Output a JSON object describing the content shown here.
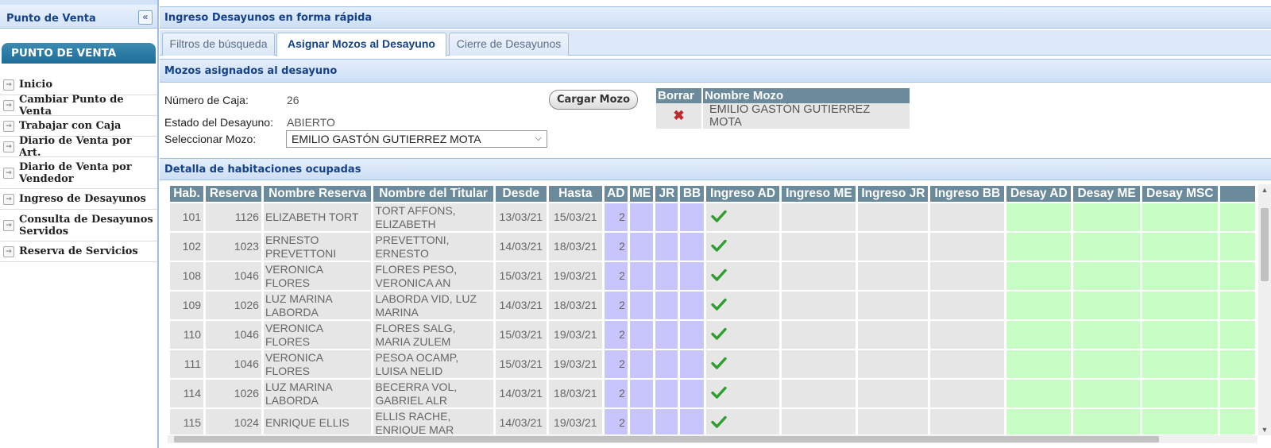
{
  "sidebar": {
    "title": "Punto de Venta",
    "collapse_icon": "«",
    "section_header": "PUNTO DE VENTA",
    "items": [
      {
        "label": "Inicio"
      },
      {
        "label": "Cambiar Punto de Venta"
      },
      {
        "label": "Trabajar con Caja"
      },
      {
        "label": "Diario de Venta por Art."
      },
      {
        "label": "Diario de Venta por Vendedor"
      },
      {
        "label": "Ingreso de Desayunos"
      },
      {
        "label": "Consulta de Desayunos Servidos"
      },
      {
        "label": "Reserva de Servicios"
      }
    ]
  },
  "main": {
    "title": "Ingreso Desayunos en forma rápida",
    "tabs": [
      {
        "label": "Filtros de búsqueda"
      },
      {
        "label": "Asignar Mozos al Desayuno"
      },
      {
        "label": "Cierre de Desayunos"
      }
    ],
    "active_tab": "Asignar Mozos al Desayuno"
  },
  "mozos": {
    "section_title": "Mozos asignados al desayuno",
    "caja_label": "Número de Caja:",
    "caja_value": "26",
    "estado_label": "Estado del Desayuno:",
    "estado_value": "ABIERTO",
    "select_label": "Seleccionar Mozo:",
    "select_value": "EMILIO GASTÓN GUTIERREZ MOTA",
    "cargar_button": "Cargar Mozo",
    "table_headers": {
      "borrar": "Borrar",
      "nombre": "Nombre Mozo"
    },
    "rows": [
      {
        "nombre": "EMILIO GASTÓN GUTIERREZ MOTA"
      }
    ]
  },
  "detalle": {
    "section_title": "Detalla de habitaciones ocupadas",
    "columns": [
      "Hab.",
      "Reserva",
      "Nombre Reserva",
      "Nombre del Titular",
      "Desde",
      "Hasta",
      "AD",
      "ME",
      "JR",
      "BB",
      "Ingreso AD",
      "Ingreso ME",
      "Ingreso JR",
      "Ingreso BB",
      "Desay AD",
      "Desay ME",
      "Desay MSC",
      ""
    ],
    "rows": [
      {
        "hab": "101",
        "reserva": "1126",
        "nombre_reserva": "ELIZABETH TORT",
        "titular": "TORT AFFONS, ELIZABETH",
        "desde": "13/03/21",
        "hasta": "15/03/21",
        "ad": "2",
        "ingreso_ad": true
      },
      {
        "hab": "102",
        "reserva": "1023",
        "nombre_reserva": "ERNESTO PREVETTONI",
        "titular": "PREVETTONI, ERNESTO",
        "desde": "14/03/21",
        "hasta": "18/03/21",
        "ad": "2",
        "ingreso_ad": true
      },
      {
        "hab": "108",
        "reserva": "1046",
        "nombre_reserva": "VERONICA FLORES",
        "titular": "FLORES PESO, VERONICA AN",
        "desde": "15/03/21",
        "hasta": "19/03/21",
        "ad": "2",
        "ingreso_ad": true
      },
      {
        "hab": "109",
        "reserva": "1026",
        "nombre_reserva": "LUZ MARINA LABORDA",
        "titular": "LABORDA VID, LUZ MARINA",
        "desde": "14/03/21",
        "hasta": "18/03/21",
        "ad": "2",
        "ingreso_ad": true
      },
      {
        "hab": "110",
        "reserva": "1046",
        "nombre_reserva": "VERONICA FLORES",
        "titular": "FLORES SALG, MARIA ZULEM",
        "desde": "15/03/21",
        "hasta": "19/03/21",
        "ad": "2",
        "ingreso_ad": true
      },
      {
        "hab": "111",
        "reserva": "1046",
        "nombre_reserva": "VERONICA FLORES",
        "titular": "PESOA OCAMP, LUISA NELID",
        "desde": "15/03/21",
        "hasta": "19/03/21",
        "ad": "2",
        "ingreso_ad": true
      },
      {
        "hab": "114",
        "reserva": "1026",
        "nombre_reserva": "LUZ MARINA LABORDA",
        "titular": "BECERRA VOL, GABRIEL ALR",
        "desde": "14/03/21",
        "hasta": "18/03/21",
        "ad": "2",
        "ingreso_ad": true
      },
      {
        "hab": "115",
        "reserva": "1024",
        "nombre_reserva": "ENRIQUE ELLIS",
        "titular": "ELLIS RACHE, ENRIQUE MAR",
        "desde": "14/03/21",
        "hasta": "19/03/21",
        "ad": "2",
        "ingreso_ad": true
      }
    ]
  },
  "colors": {
    "header_blue": "#15428b",
    "grid_header": "#6b8a9b",
    "meal_purple": "#c7c5fb",
    "desay_green": "#c8fdc5",
    "check_green": "#2e9e2e",
    "delete_red": "#c0292b"
  },
  "icons": {
    "collapse": "double-chevron-left-icon",
    "menu_item": "arrow-right-icon",
    "delete": "red-x-icon",
    "ingreso": "green-check-icon",
    "select": "chevron-down-icon"
  }
}
